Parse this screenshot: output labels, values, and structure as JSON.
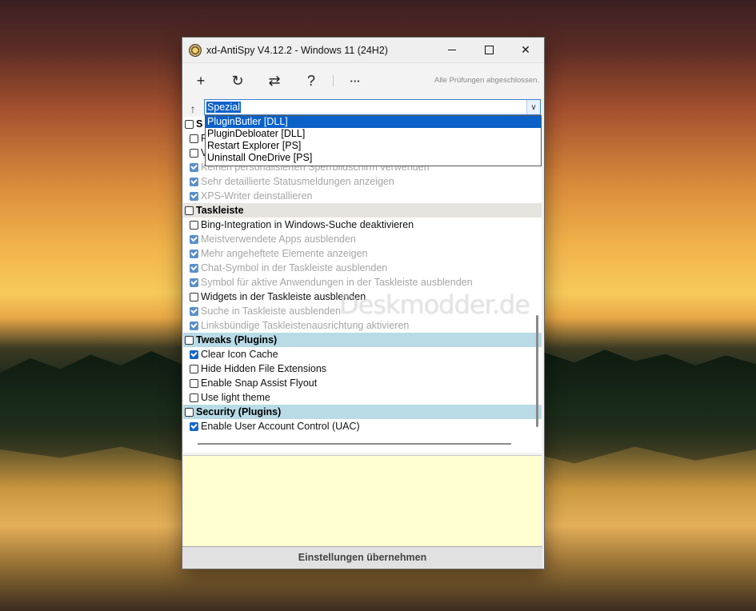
{
  "window": {
    "title": "xd-AntiSpy V4.12.2 - Windows 11 (24H2)"
  },
  "toolbar": {
    "add_icon": "+",
    "refresh_icon": "↻",
    "switch_icon": "⇄",
    "help_icon": "?",
    "more_icon": "···",
    "status": "Alle Prüfungen abgeschlossen."
  },
  "filter": {
    "selected": "Spezial",
    "options": [
      "PluginButler [DLL]",
      "PluginDebloater [DLL]",
      "Restart Explorer [PS]",
      "Uninstall OneDrive [PS]"
    ],
    "highlighted": "PluginButler [DLL]"
  },
  "list": {
    "rows": [
      {
        "kind": "cat",
        "style": "plain",
        "label": "S",
        "checked": false
      },
      {
        "kind": "item",
        "label": "P",
        "checked": false,
        "dim": false
      },
      {
        "kind": "item",
        "label": "V",
        "checked": false,
        "dim": false
      },
      {
        "kind": "item",
        "label": "Keinen personalisierten Sperrbildschirm verwenden",
        "checked": true,
        "dim": true
      },
      {
        "kind": "item",
        "label": "Sehr detaillierte Statusmeldungen anzeigen",
        "checked": true,
        "dim": true
      },
      {
        "kind": "item",
        "label": "XPS-Writer deinstallieren",
        "checked": true,
        "dim": true
      },
      {
        "kind": "cat",
        "style": "gray",
        "label": "Taskleiste",
        "checked": false
      },
      {
        "kind": "item",
        "label": "Bing-Integration in Windows-Suche deaktivieren",
        "checked": false,
        "dim": false
      },
      {
        "kind": "item",
        "label": "Meistverwendete Apps ausblenden",
        "checked": true,
        "dim": true
      },
      {
        "kind": "item",
        "label": "Mehr angeheftete Elemente anzeigen",
        "checked": true,
        "dim": true
      },
      {
        "kind": "item",
        "label": "Chat-Symbol in der Taskleiste ausblenden",
        "checked": true,
        "dim": true
      },
      {
        "kind": "item",
        "label": "Symbol für aktive Anwendungen in der Taskleiste ausblenden",
        "checked": true,
        "dim": true
      },
      {
        "kind": "item",
        "label": "Widgets in der Taskleiste ausblenden",
        "checked": false,
        "dim": false
      },
      {
        "kind": "item",
        "label": "Suche in Taskleiste ausblenden",
        "checked": true,
        "dim": true
      },
      {
        "kind": "item",
        "label": "Linksbündige Taskleistenausrichtung aktivieren",
        "checked": true,
        "dim": true
      },
      {
        "kind": "cat",
        "style": "blue",
        "label": "Tweaks (Plugins)",
        "checked": false
      },
      {
        "kind": "item",
        "label": "Clear Icon Cache",
        "checked": true,
        "dim": false
      },
      {
        "kind": "item",
        "label": "Hide Hidden File Extensions",
        "checked": false,
        "dim": false
      },
      {
        "kind": "item",
        "label": "Enable Snap Assist Flyout",
        "checked": false,
        "dim": false
      },
      {
        "kind": "item",
        "label": "Use light theme",
        "checked": false,
        "dim": false
      },
      {
        "kind": "cat",
        "style": "blue",
        "label": "Security (Plugins)",
        "checked": false
      },
      {
        "kind": "item",
        "label": "Enable User Account Control (UAC)",
        "checked": true,
        "dim": false
      }
    ]
  },
  "watermark": "Deskmodder.de",
  "apply_button": "Einstellungen übernehmen",
  "colors": {
    "accent": "#0a62c8",
    "category_gray": "#e6e4df",
    "category_blue": "#b8dbe6",
    "log_bg": "#ffffcf"
  }
}
